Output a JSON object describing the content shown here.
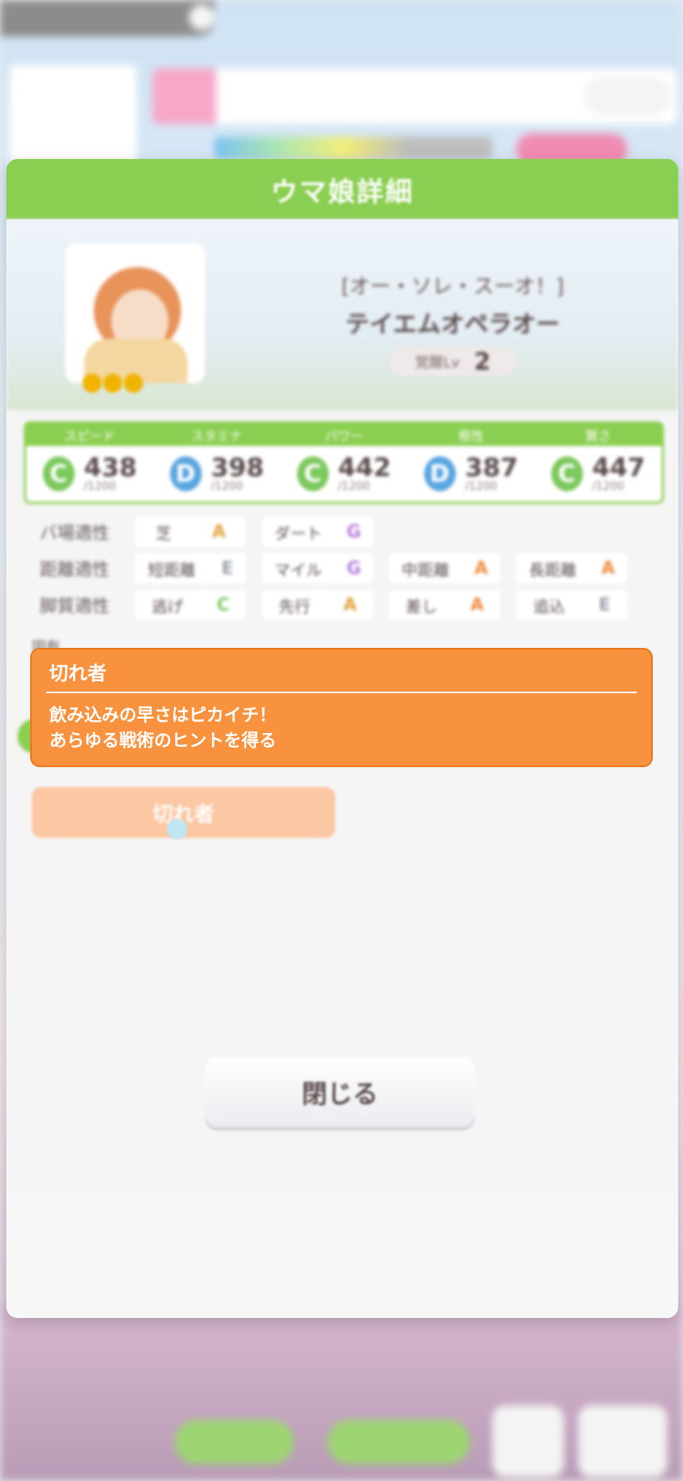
{
  "tooltip": {
    "title": "切れ者",
    "description_line1": "飲み込みの早さはピカイチ！",
    "description_line2": "あらゆる戦術のヒントを得る"
  },
  "modal": {
    "title": "ウマ娘詳細",
    "close_label": "閉じる"
  },
  "character": {
    "epithet": "[オー・ソレ・スーオ！]",
    "name": "テイエムオペラオー",
    "level_label": "覚醒Lv",
    "level": "2",
    "stars": 3
  },
  "stats": [
    {
      "label": "スピード",
      "rank": "C",
      "value": "438",
      "max": "/1200"
    },
    {
      "label": "スタミナ",
      "rank": "D",
      "value": "398",
      "max": "/1200"
    },
    {
      "label": "パワー",
      "rank": "C",
      "value": "442",
      "max": "/1200"
    },
    {
      "label": "根性",
      "rank": "D",
      "value": "387",
      "max": "/1200"
    },
    {
      "label": "賢さ",
      "rank": "C",
      "value": "447",
      "max": "/1200"
    }
  ],
  "aptitude": {
    "track": {
      "label": "バ場適性",
      "items": [
        {
          "name": "芝",
          "grade": "A"
        },
        {
          "name": "ダート",
          "grade": "G"
        }
      ]
    },
    "distance": {
      "label": "距離適性",
      "items": [
        {
          "name": "短距離",
          "grade": "E"
        },
        {
          "name": "マイル",
          "grade": "G"
        },
        {
          "name": "中距離",
          "grade": "A"
        },
        {
          "name": "長距離",
          "grade": "A"
        }
      ]
    },
    "style": {
      "label": "脚質適性",
      "items": [
        {
          "name": "逃げ",
          "grade": "C"
        },
        {
          "name": "先行",
          "grade": "A"
        },
        {
          "name": "差し",
          "grade": "A"
        },
        {
          "name": "追込",
          "grade": "E"
        }
      ]
    }
  },
  "skill_section_label": "固有",
  "skill_button_label": "切れ者",
  "colors": {
    "header_green": "#8bcf52",
    "tooltip_orange": "#f9923e",
    "skill_button": "#fcc7a3"
  },
  "icons": [
    "pointer-icon",
    "star-icon"
  ]
}
